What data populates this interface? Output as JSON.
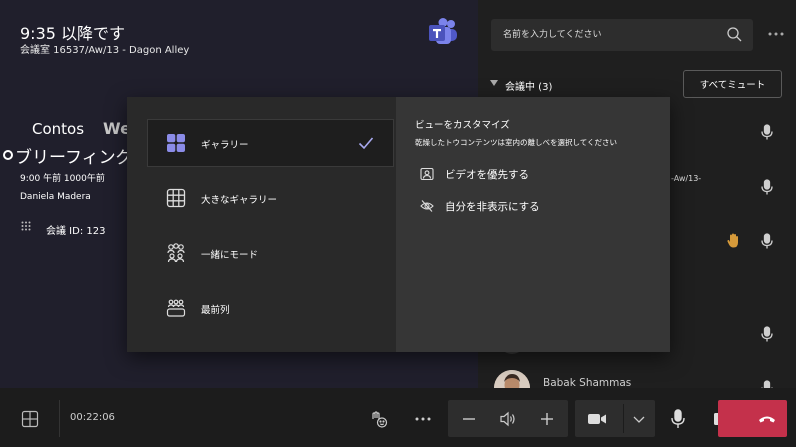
{
  "meeting": {
    "title": "9:35 以降です",
    "room": "会議室 16537/Aw/13 - Dagon Alley",
    "org_name": "Contos",
    "org_name_tail": "We",
    "event_title": "ブリーフィング",
    "time_line": "9:00 午前 1000午前",
    "organizer": "Daniela Madera",
    "meeting_id": "会議 ID: 123"
  },
  "panel": {
    "search_placeholder": "名前を入力してください",
    "in_meeting_label": "会議中 (3)",
    "mute_all_label": "すべてミュート",
    "partial_location": "-Aw/13-",
    "participant_name": "Babak Shammas"
  },
  "view_menu": {
    "layouts": [
      {
        "label": "ギャラリー",
        "icon": "gallery-icon",
        "selected": true
      },
      {
        "label": "大きなギャラリー",
        "icon": "large-gallery-icon",
        "selected": false
      },
      {
        "label": "一緒にモード",
        "icon": "together-mode-icon",
        "selected": false
      },
      {
        "label": "最前列",
        "icon": "front-row-icon",
        "selected": false
      }
    ],
    "customize_title": "ビューをカスタマイズ",
    "customize_subtitle": "乾燥したトウコンテンツは室内の離しべを選択してください",
    "options": [
      {
        "label": "ビデオを優先する",
        "icon": "video-priority-icon"
      },
      {
        "label": "自分を非表示にする",
        "icon": "hide-self-icon"
      }
    ]
  },
  "toolbar": {
    "timer": "00:22:06"
  },
  "colors": {
    "stage_bg": "#201f2c",
    "panel_bg": "#1f1f1f",
    "popup_left_bg": "#292929",
    "popup_right_bg": "#363636",
    "accent": "#8b8ce8",
    "hangup": "#c4314b",
    "raise_hand": "#d69a3a"
  }
}
